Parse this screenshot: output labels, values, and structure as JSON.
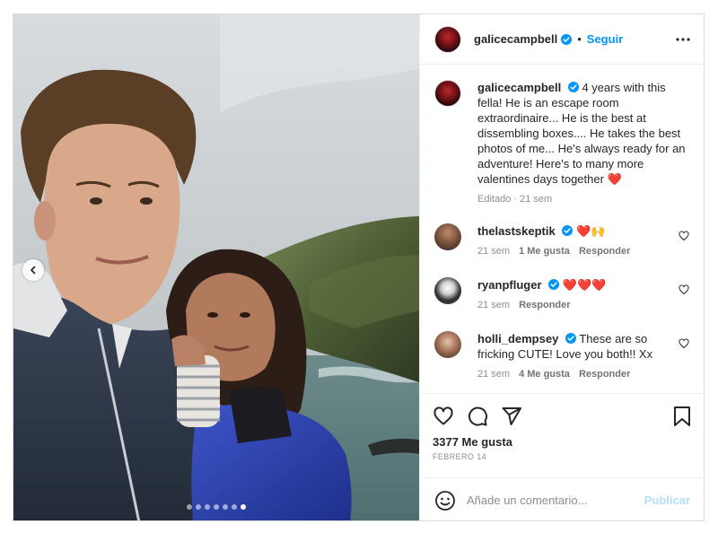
{
  "post": {
    "author": "galicecampbell",
    "follow_label": "Seguir",
    "separator": "•",
    "media": {
      "slide_count": 7,
      "active_slide": 6
    },
    "caption": {
      "username": "galicecampbell",
      "text": "4 years with this fella! He is an escape room extraordinaire... He is the best at dissembling boxes.... He takes the best photos of me... He's always ready for an adventure! Here's to many more valentines days together",
      "emoji": "❤️",
      "meta": "Editado · 21 sem"
    },
    "comments": [
      {
        "username": "thelastskeptik",
        "text": "❤️🙌",
        "time": "21 sem",
        "likes": "1 Me gusta",
        "reply": "Responder",
        "verified": true
      },
      {
        "username": "ryanpfluger",
        "text": "❤️❤️❤️",
        "time": "21 sem",
        "likes": "",
        "reply": "Responder",
        "verified": true
      },
      {
        "username": "holli_dempsey",
        "text": "These are so fricking CUTE! Love you both!! Xx",
        "time": "21 sem",
        "likes": "4 Me gusta",
        "reply": "Responder",
        "verified": true
      }
    ],
    "likes_count": "3377 Me gusta",
    "date": "FEBRERO 14",
    "add_comment": {
      "placeholder": "Añade un comentario...",
      "publish_label": "Publicar"
    }
  },
  "colors": {
    "accent": "#0095f6",
    "heart": "#ed4956",
    "verified": "#0095f6"
  }
}
